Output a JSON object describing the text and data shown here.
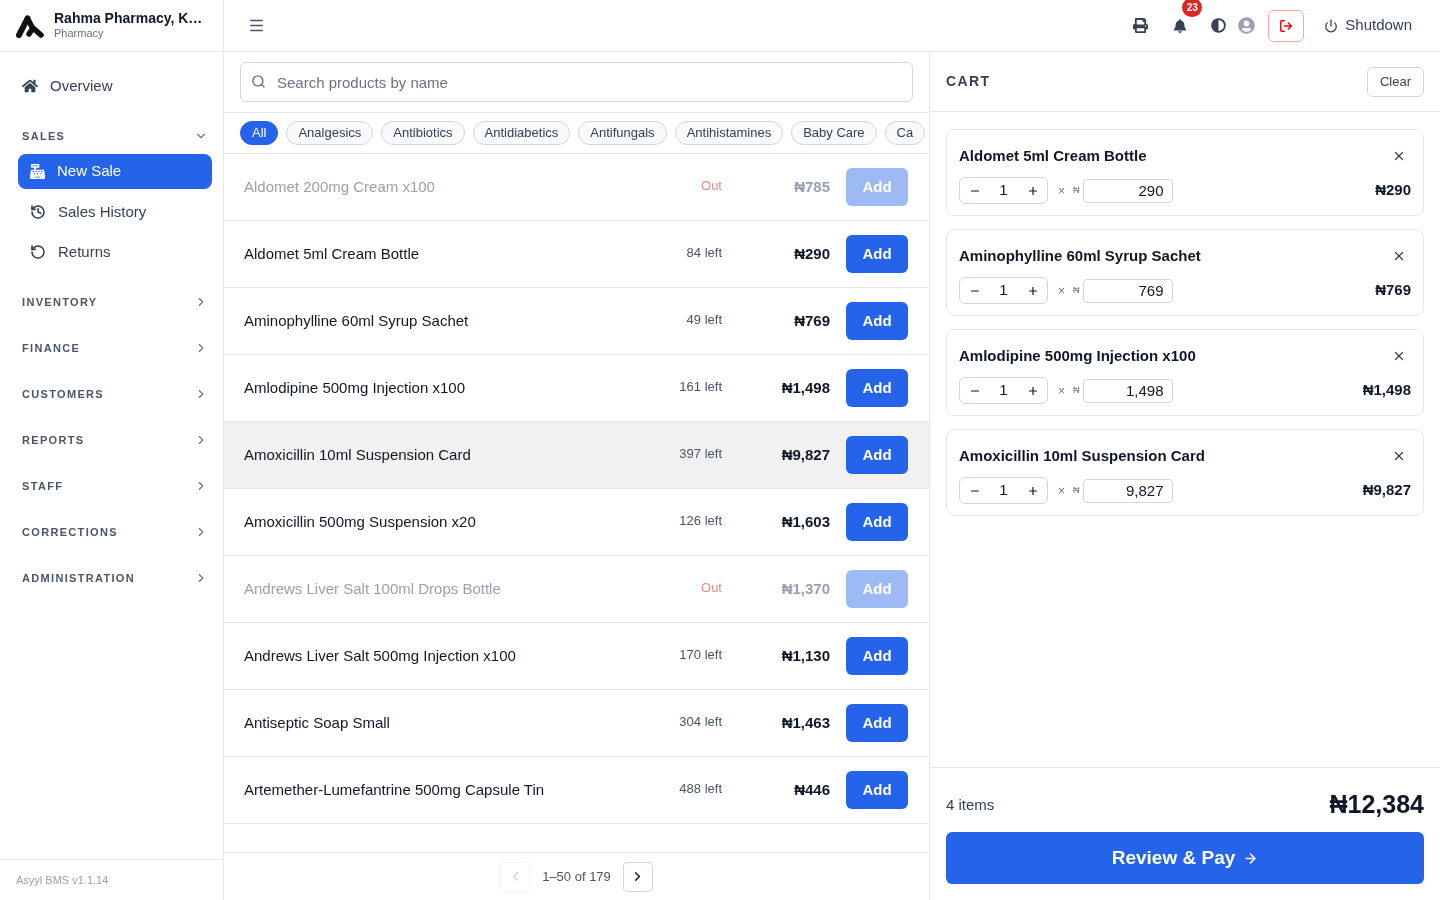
{
  "sidebar": {
    "brand": {
      "title": "Rahma Pharmacy, K…",
      "subtitle": "Pharmacy"
    },
    "overview": {
      "label": "Overview",
      "selected": false
    },
    "sections": [
      {
        "label": "SALES",
        "expanded": true,
        "items": [
          {
            "label": "New Sale",
            "kind": "register",
            "selected": true
          },
          {
            "label": "Sales History",
            "kind": "history",
            "selected": false
          },
          {
            "label": "Returns",
            "kind": "returns",
            "selected": false
          }
        ]
      },
      {
        "label": "INVENTORY",
        "expanded": false
      },
      {
        "label": "FINANCE",
        "expanded": false
      },
      {
        "label": "CUSTOMERS",
        "expanded": false
      },
      {
        "label": "REPORTS",
        "expanded": false
      },
      {
        "label": "STAFF",
        "expanded": false
      },
      {
        "label": "CORRECTIONS",
        "expanded": false
      },
      {
        "label": "ADMINISTRATION",
        "expanded": false
      }
    ],
    "footer": "Asyyl BMS v1.1.14"
  },
  "header": {
    "notification_count": "23",
    "shutdown": "Shutdown"
  },
  "search": {
    "placeholder": "Search products by name"
  },
  "categories": [
    {
      "label": "All",
      "selected": true
    },
    {
      "label": "Analgesics",
      "selected": false
    },
    {
      "label": "Antibiotics",
      "selected": false
    },
    {
      "label": "Antidiabetics",
      "selected": false
    },
    {
      "label": "Antifungals",
      "selected": false
    },
    {
      "label": "Antihistamines",
      "selected": false
    },
    {
      "label": "Baby Care",
      "selected": false
    },
    {
      "label": "Ca",
      "selected": false
    }
  ],
  "products": [
    {
      "name": "Aldomet 200mg Cream x100",
      "stock": "Out",
      "price": "₦785",
      "button": "Add",
      "disabled": true,
      "selected": false
    },
    {
      "name": "Aldomet 5ml Cream Bottle",
      "stock": "84 left",
      "price": "₦290",
      "button": "Add",
      "disabled": false,
      "selected": false
    },
    {
      "name": "Aminophylline 60ml Syrup Sachet",
      "stock": "49 left",
      "price": "₦769",
      "button": "Add",
      "disabled": false,
      "selected": false
    },
    {
      "name": "Amlodipine 500mg Injection x100",
      "stock": "161 left",
      "price": "₦1,498",
      "button": "Add",
      "disabled": false,
      "selected": false
    },
    {
      "name": "Amoxicillin 10ml Suspension Card",
      "stock": "397 left",
      "price": "₦9,827",
      "button": "Add",
      "disabled": false,
      "selected": true
    },
    {
      "name": "Amoxicillin 500mg Suspension x20",
      "stock": "126 left",
      "price": "₦1,603",
      "button": "Add",
      "disabled": false,
      "selected": false
    },
    {
      "name": "Andrews Liver Salt 100ml Drops Bottle",
      "stock": "Out",
      "price": "₦1,370",
      "button": "Add",
      "disabled": true,
      "selected": false
    },
    {
      "name": "Andrews Liver Salt 500mg Injection x100",
      "stock": "170 left",
      "price": "₦1,130",
      "button": "Add",
      "disabled": false,
      "selected": false
    },
    {
      "name": "Antiseptic Soap Small",
      "stock": "304 left",
      "price": "₦1,463",
      "button": "Add",
      "disabled": false,
      "selected": false
    },
    {
      "name": "Artemether-Lumefantrine 500mg Capsule Tin",
      "stock": "488 left",
      "price": "₦446",
      "button": "Add",
      "disabled": false,
      "selected": false
    }
  ],
  "pagination": {
    "range": "1–50 of 179",
    "prev_disabled": true,
    "next_disabled": false
  },
  "cart": {
    "title": "CART",
    "clear": "Clear",
    "items": [
      {
        "name": "Aldomet 5ml Cream Bottle",
        "quantity": "1",
        "multiply": "×",
        "currency": "₦",
        "unit_price": "290",
        "total": "₦290"
      },
      {
        "name": "Aminophylline 60ml Syrup Sachet",
        "quantity": "1",
        "multiply": "×",
        "currency": "₦",
        "unit_price": "769",
        "total": "₦769"
      },
      {
        "name": "Amlodipine 500mg Injection x100",
        "quantity": "1",
        "multiply": "×",
        "currency": "₦",
        "unit_price": "1,498",
        "total": "₦1,498"
      },
      {
        "name": "Amoxicillin 10ml Suspension Card",
        "quantity": "1",
        "multiply": "×",
        "currency": "₦",
        "unit_price": "9,827",
        "total": "₦9,827"
      }
    ],
    "count": "4 items",
    "total": "₦12,384",
    "checkout": "Review & Pay"
  }
}
